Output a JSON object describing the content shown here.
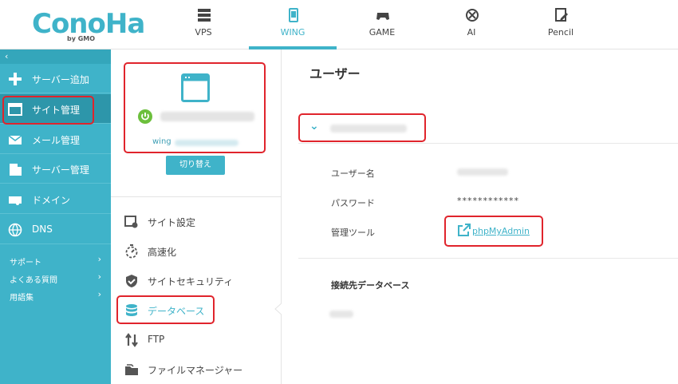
{
  "header": {
    "logo_text": "ConoHa",
    "logo_sub": "by GMO",
    "tabs": [
      {
        "label": "VPS",
        "icon": "server-icon"
      },
      {
        "label": "WING",
        "icon": "phone-icon"
      },
      {
        "label": "GAME",
        "icon": "gamepad-icon"
      },
      {
        "label": "AI",
        "icon": "ai-icon"
      },
      {
        "label": "Pencil",
        "icon": "pencil-icon"
      }
    ],
    "active_tab": "WING"
  },
  "sidebar": {
    "collapse": "‹",
    "items": [
      {
        "label": "サーバー追加",
        "icon": "plus-icon"
      },
      {
        "label": "サイト管理",
        "icon": "window-icon"
      },
      {
        "label": "メール管理",
        "icon": "mail-icon"
      },
      {
        "label": "サーバー管理",
        "icon": "server-manage-icon"
      },
      {
        "label": "ドメイン",
        "icon": "domain-icon"
      },
      {
        "label": "DNS",
        "icon": "globe-icon"
      }
    ],
    "subitems": [
      {
        "label": "サポート",
        "chev": "›"
      },
      {
        "label": "よくある質問",
        "chev": "›"
      },
      {
        "label": "用語集",
        "chev": "›"
      }
    ]
  },
  "server": {
    "wing_label": "wing",
    "switch_label": "切り替え"
  },
  "menu": [
    {
      "label": "サイト設定",
      "icon": "site-settings-icon"
    },
    {
      "label": "高速化",
      "icon": "stopwatch-icon"
    },
    {
      "label": "サイトセキュリティ",
      "icon": "shield-icon"
    },
    {
      "label": "データベース",
      "icon": "database-icon"
    },
    {
      "label": "FTP",
      "icon": "transfer-icon"
    },
    {
      "label": "ファイルマネージャー",
      "icon": "folder-icon"
    }
  ],
  "main": {
    "title": "ユーザー",
    "user_chevron": "⌄",
    "user_name_label": "ユーザー名",
    "password_label": "パスワード",
    "password_value": "************",
    "tool_label": "管理ツール",
    "tool_link": "phpMyAdmin",
    "db_section_title": "接続先データベース"
  },
  "colors": {
    "accent": "#3fb3c9",
    "highlight": "#e0242c",
    "power": "#6cbf3c"
  }
}
